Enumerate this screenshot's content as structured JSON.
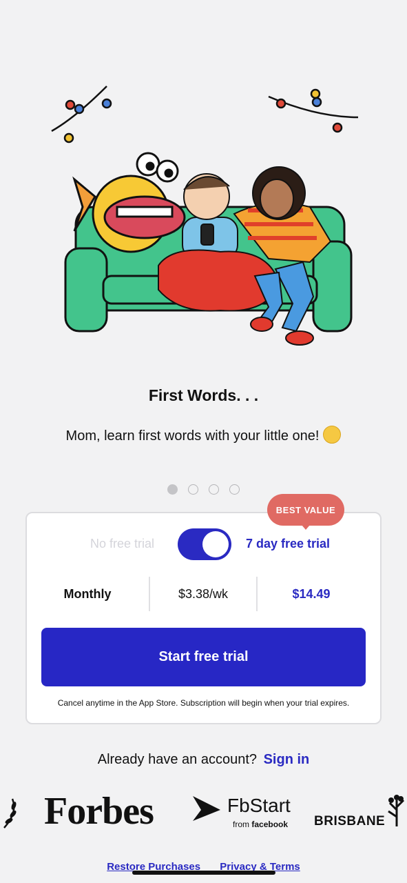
{
  "hero": {
    "title": "First Words. . .",
    "subtitle": "Mom, learn first words with your little one!"
  },
  "pager": {
    "count": 4,
    "active_index": 0
  },
  "plan": {
    "badge": "BEST VALUE",
    "no_trial_label": "No free trial",
    "trial_label": "7 day free trial",
    "trial_enabled": true,
    "period": "Monthly",
    "weekly_price": "$3.38/wk",
    "total_price": "$14.49",
    "cta_label": "Start free trial",
    "fine_print": "Cancel anytime in the App Store. Subscription will begin when your trial expires."
  },
  "account": {
    "prompt": "Already have an account?",
    "sign_in": "Sign in"
  },
  "press": {
    "forbes": "Forbes",
    "fbstart": "FbStart",
    "fbstart_from": "from",
    "fbstart_brand": "facebook",
    "brisbane": "BRISBANE"
  },
  "footer": {
    "restore": "Restore Purchases",
    "privacy": "Privacy & Terms"
  },
  "colors": {
    "accent": "#2727c5",
    "badge": "#e06a63",
    "background": "#f2f2f3"
  }
}
